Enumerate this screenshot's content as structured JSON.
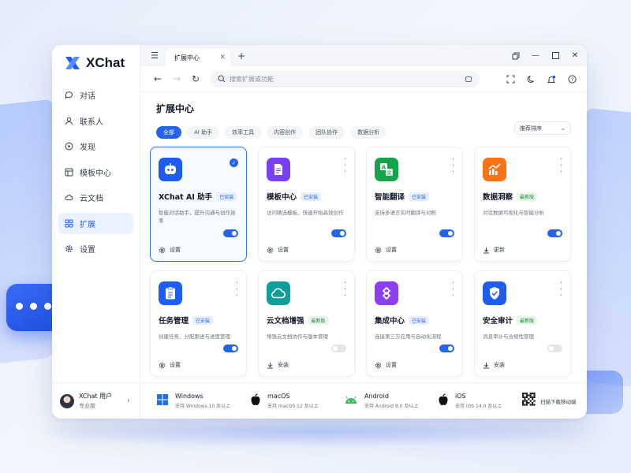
{
  "app": {
    "name": "XChat"
  },
  "sidebar": {
    "items": [
      {
        "label": "对话",
        "icon": "chat-icon"
      },
      {
        "label": "联系人",
        "icon": "contact-icon"
      },
      {
        "label": "发现",
        "icon": "compass-icon"
      },
      {
        "label": "模板中心",
        "icon": "template-icon"
      },
      {
        "label": "云文档",
        "icon": "cloud-icon"
      },
      {
        "label": "扩展",
        "icon": "extension-icon",
        "active": true
      },
      {
        "label": "设置",
        "icon": "gear-icon"
      }
    ],
    "user": {
      "name": "XChat 用户",
      "plan": "专业版"
    }
  },
  "tabs": [
    {
      "label": "扩展中心"
    }
  ],
  "search": {
    "placeholder": "搜索扩展或功能"
  },
  "page": {
    "title": "扩展中心"
  },
  "filters": [
    {
      "label": "全部",
      "active": true
    },
    {
      "label": "AI 助手"
    },
    {
      "label": "效率工具"
    },
    {
      "label": "内容创作"
    },
    {
      "label": "团队协作"
    },
    {
      "label": "数据分析"
    }
  ],
  "sort": {
    "label": "推荐排序"
  },
  "extensions": [
    {
      "title": "XChat AI 助手",
      "badge": "已安装",
      "desc": "智能对话助手，提升沟通与创作效率",
      "action": "设置",
      "enabled": true,
      "selected": true,
      "color": "#1f5cf0"
    },
    {
      "title": "模板中心",
      "badge": "已安装",
      "desc": "访问精选模板，快速开始高效创作",
      "action": "设置",
      "enabled": true,
      "color": "#7b3ff2"
    },
    {
      "title": "智能翻译",
      "badge": "已安装",
      "desc": "支持多语言实时翻译与对照",
      "action": "设置",
      "enabled": true,
      "color": "#16a34a"
    },
    {
      "title": "数据洞察",
      "badge": "最新版",
      "desc": "对话数据可视化与智能分析",
      "action": "更新",
      "enabled": true,
      "color": "#f97316"
    },
    {
      "title": "任务管理",
      "badge": "已安装",
      "desc": "创建任务、分配跟进与进度管理",
      "action": "设置",
      "enabled": true,
      "color": "#1f5cf0"
    },
    {
      "title": "云文档增强",
      "badge": "最新版",
      "desc": "增强云文档协作与版本管理",
      "action": "安装",
      "enabled": false,
      "color": "#0f9f9a"
    },
    {
      "title": "集成中心",
      "badge": "已安装",
      "desc": "连接第三方应用与自动化流程",
      "action": "设置",
      "enabled": true,
      "color": "#8b3ff0"
    },
    {
      "title": "安全审计",
      "badge": "最新版",
      "desc": "消息审计与合规性管理",
      "action": "安装",
      "enabled": false,
      "color": "#1f5cf0"
    }
  ],
  "platforms": [
    {
      "name": "Windows",
      "req": "支持 Windows 10 及以上",
      "icon": "windows-icon"
    },
    {
      "name": "macOS",
      "req": "支持 macOS 12 及以上",
      "icon": "apple-icon"
    },
    {
      "name": "Android",
      "req": "支持 Android 8.0 及以上",
      "icon": "android-icon"
    },
    {
      "name": "iOS",
      "req": "支持 iOS 14.0 及以上",
      "icon": "apple-icon"
    }
  ],
  "qr": {
    "label": "扫描下载移动端"
  }
}
